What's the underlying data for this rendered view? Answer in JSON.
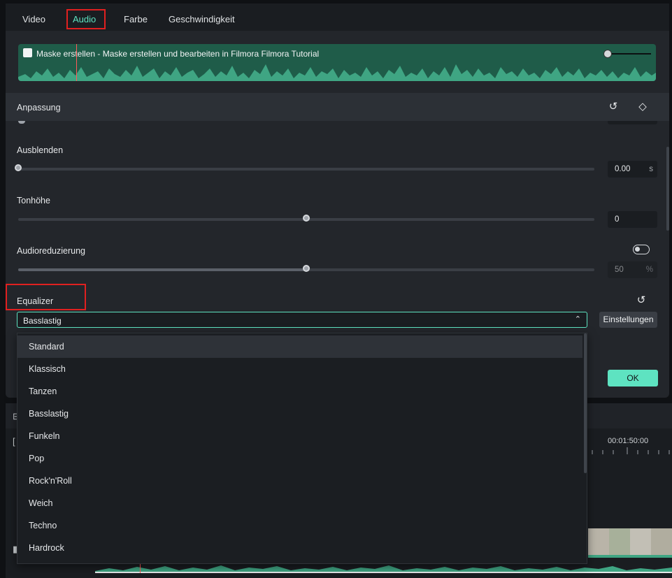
{
  "tabs": [
    {
      "label": "Video"
    },
    {
      "label": "Audio"
    },
    {
      "label": "Farbe"
    },
    {
      "label": "Geschwindigkeit"
    }
  ],
  "clip": {
    "title": "Maske erstellen - Maske erstellen und bearbeiten in Filmora  Filmora Tutorial"
  },
  "section": {
    "label": "Anpassung"
  },
  "fadeout": {
    "label": "Ausblenden",
    "value": "0.00",
    "unit": "s",
    "level": 0
  },
  "pitch": {
    "label": "Tonhöhe",
    "value": "0",
    "level": 0.5
  },
  "denoise": {
    "label": "Audioreduzierung",
    "value": "50",
    "unit": "%",
    "level": 0.5,
    "enabled": false
  },
  "equalizer": {
    "label": "Equalizer",
    "selected": "Basslastig",
    "settings_label": "Einstellungen",
    "options": [
      "Standard",
      "Klassisch",
      "Tanzen",
      "Basslastig",
      "Funkeln",
      "Pop",
      "Rock'n'Roll",
      "Weich",
      "Techno",
      "Hardrock"
    ],
    "highlighted": "Standard"
  },
  "ok_label": "OK",
  "timeline": {
    "timecode": "00:01:50:00"
  },
  "colors": {
    "accent": "#5ee3c1",
    "wave": "#1f5c49",
    "highlight_box": "#e02020"
  }
}
